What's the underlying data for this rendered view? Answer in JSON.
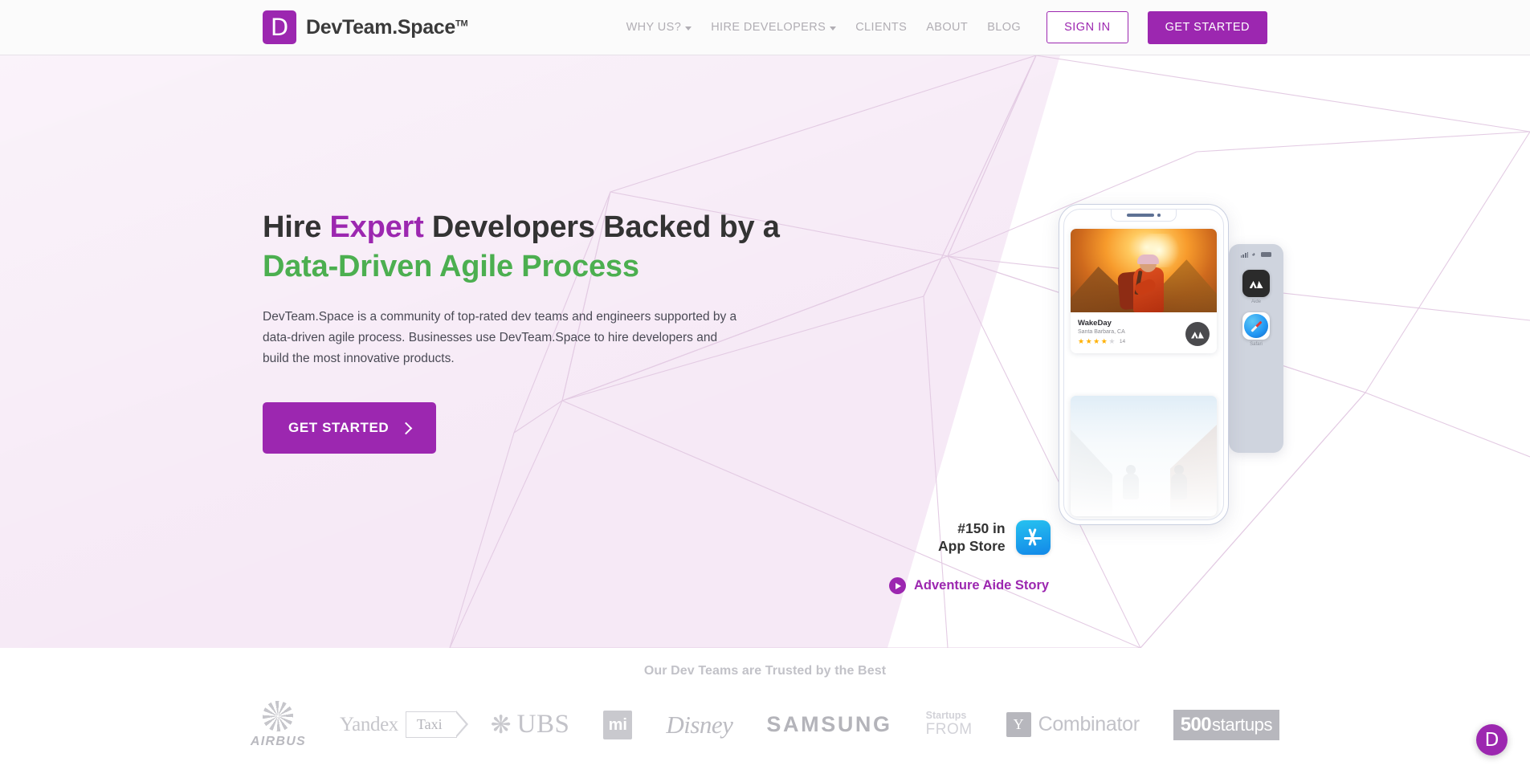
{
  "header": {
    "logo": {
      "mark": "D",
      "text": "DevTeam.Space",
      "tm": "TM"
    },
    "nav": [
      {
        "label": "WHY US?",
        "has_caret": true
      },
      {
        "label": "HIRE DEVELOPERS",
        "has_caret": true
      },
      {
        "label": "CLIENTS",
        "has_caret": false
      },
      {
        "label": "ABOUT",
        "has_caret": false
      },
      {
        "label": "BLOG",
        "has_caret": false
      }
    ],
    "sign_in_label": "SIGN IN",
    "get_started_label": "GET STARTED"
  },
  "hero": {
    "headline": {
      "part1": "Hire ",
      "highlight1": "Expert",
      "part2": " Developers Backed by a ",
      "highlight2": "Data-Driven Agile Process"
    },
    "paragraph": "DevTeam.Space is a community of top-rated dev teams and engineers supported by a data-driven agile process. Businesses use DevTeam.Space to hire developers and build the most innovative products.",
    "cta_label": "GET STARTED",
    "appstore": {
      "rank_line1": "#150 in",
      "rank_line2": "App Store"
    },
    "video_link_label": "Adventure Aide Story",
    "phone": {
      "card": {
        "title": "WakeDay",
        "location": "Santa Barbara, CA",
        "stars_filled": 4,
        "stars_total": 5,
        "review_count": "14"
      },
      "side_apps": [
        {
          "label": "Aide"
        },
        {
          "label": "Safari"
        }
      ]
    }
  },
  "trusted": {
    "title": "Our Dev Teams are Trusted by the Best",
    "logos": [
      {
        "name": "Airbus",
        "word": "AIRBUS"
      },
      {
        "name": "Yandex Taxi",
        "word": "Yandex",
        "word2": "Taxi"
      },
      {
        "name": "UBS",
        "word": "UBS"
      },
      {
        "name": "Xiaomi",
        "word": "mi"
      },
      {
        "name": "Disney",
        "word": "Disney"
      },
      {
        "name": "Samsung",
        "word": "SAMSUNG"
      },
      {
        "name": "Startups From",
        "word": "Startups",
        "word2": "FROM"
      },
      {
        "name": "Y Combinator",
        "word": "Y",
        "word2": "Combinator"
      },
      {
        "name": "500 Startups",
        "word": "500",
        "word2": "startups"
      }
    ]
  },
  "chat_widget": {
    "label": "D"
  },
  "colors": {
    "brand_purple": "#9c27b0",
    "accent_green": "#4caf50",
    "hero_bg": "#f6e9f6",
    "header_bg": "#fbfbfb",
    "text_dark": "#333333"
  }
}
